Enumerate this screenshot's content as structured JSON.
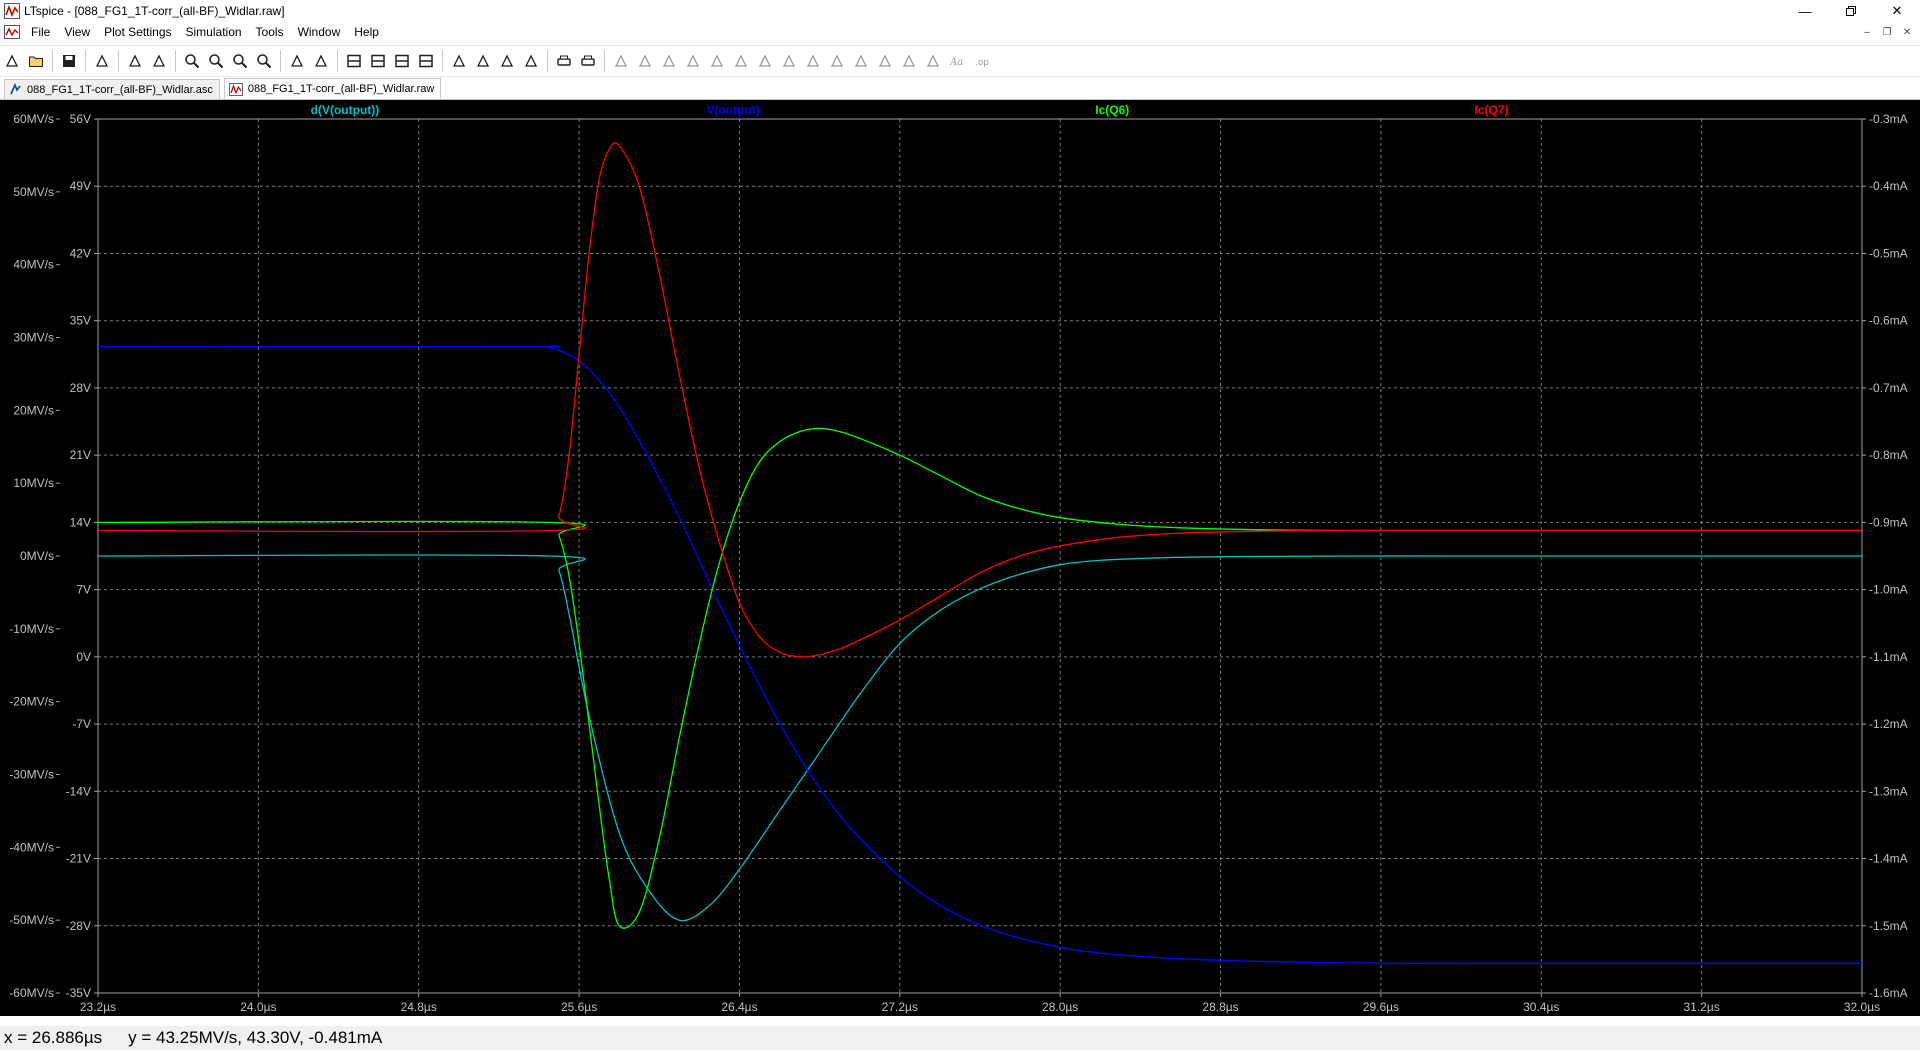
{
  "window": {
    "title": "LTspice - [088_FG1_1T-corr_(all-BF)_Widlar.raw]"
  },
  "menu": {
    "items": [
      "File",
      "View",
      "Plot Settings",
      "Simulation",
      "Tools",
      "Window",
      "Help"
    ]
  },
  "toolbar": {
    "groups": [
      [
        "new-schematic-icon",
        "open-icon"
      ],
      [
        "save-icon"
      ],
      [
        "control-panel-icon"
      ],
      [
        "run-icon",
        "halt-icon"
      ],
      [
        "zoom-in-icon",
        "zoom-area-icon",
        "zoom-out-icon",
        "zoom-cancel-icon"
      ],
      [
        "autorange-icon",
        "fit-y-icon"
      ],
      [
        "tile-horizontal-icon",
        "tile-vertical-icon",
        "cascade-icon",
        "close-all-icon"
      ],
      [
        "cut-icon",
        "copy-icon",
        "paste-icon",
        "find-icon"
      ],
      [
        "print-setup-icon",
        "print-icon"
      ],
      [
        "wire-icon",
        "ground-icon",
        "label-icon",
        "resistor-icon",
        "capacitor-icon",
        "inductor-icon",
        "diode-icon",
        "component-icon",
        "move-icon",
        "drag-icon",
        "undo-icon",
        "redo-icon",
        "rotate-icon",
        "mirror-icon",
        "text-icon",
        "spice-directive-icon"
      ]
    ]
  },
  "tabs": [
    {
      "label": "088_FG1_1T-corr_(all-BF)_Widlar.asc",
      "icon": "schematic-icon",
      "active": false
    },
    {
      "label": "088_FG1_1T-corr_(all-BF)_Widlar.raw",
      "icon": "waveform-icon",
      "active": true
    }
  ],
  "status": {
    "x_readout": "x = 26.886µs",
    "y_readout": "y = 43.25MV/s, 43.30V, -0.481mA"
  },
  "chart_data": {
    "type": "line",
    "background": "#000000",
    "grid": true,
    "x": {
      "min": 23.2,
      "max": 32.0,
      "unit": "µs",
      "ticks": [
        23.2,
        24.0,
        24.8,
        25.6,
        26.4,
        27.2,
        28.0,
        28.8,
        29.6,
        30.4,
        31.2,
        32.0
      ],
      "tick_labels": [
        "23.2µs",
        "24.0µs",
        "24.8µs",
        "25.6µs",
        "26.4µs",
        "27.2µs",
        "28.0µs",
        "28.8µs",
        "29.6µs",
        "30.4µs",
        "31.2µs",
        "32.0µs"
      ]
    },
    "axes": {
      "dv": {
        "min": -60,
        "max": 60,
        "ticks": [
          60,
          50,
          40,
          30,
          20,
          10,
          0,
          -10,
          -20,
          -30,
          -40,
          -50,
          -60
        ],
        "tick_labels": [
          "60MV/s",
          "50MV/s",
          "40MV/s",
          "30MV/s",
          "20MV/s",
          "10MV/s",
          "0MV/s",
          "-10MV/s",
          "-20MV/s",
          "-30MV/s",
          "-40MV/s",
          "-50MV/s",
          "-60MV/s"
        ]
      },
      "v": {
        "min": -35,
        "max": 56,
        "ticks": [
          56,
          49,
          42,
          35,
          28,
          21,
          14,
          7,
          0,
          -7,
          -14,
          -21,
          -28,
          -35
        ],
        "tick_labels": [
          "56V",
          "49V",
          "42V",
          "35V",
          "28V",
          "21V",
          "14V",
          "7V",
          "0V",
          "-7V",
          "-14V",
          "-21V",
          "-28V",
          "-35V"
        ]
      },
      "i": {
        "min": -1.6,
        "max": -0.3,
        "ticks": [
          -0.3,
          -0.4,
          -0.5,
          -0.6,
          -0.7,
          -0.8,
          -0.9,
          -1.0,
          -1.1,
          -1.2,
          -1.3,
          -1.4,
          -1.5,
          -1.6
        ],
        "tick_labels": [
          "-0.3mA",
          "-0.4mA",
          "-0.5mA",
          "-0.6mA",
          "-0.7mA",
          "-0.8mA",
          "-0.9mA",
          "-1.0mA",
          "-1.1mA",
          "-1.2mA",
          "-1.3mA",
          "-1.4mA",
          "-1.5mA",
          "-1.6mA"
        ]
      }
    },
    "series": [
      {
        "name": "d(V(output))",
        "color": "#00c0c0",
        "axis": "dv",
        "x": [
          23.2,
          25.45,
          25.5,
          25.55,
          25.65,
          25.8,
          25.95,
          26.1,
          26.25,
          26.4,
          26.6,
          26.8,
          27.0,
          27.2,
          27.4,
          27.6,
          27.8,
          28.0,
          28.2,
          28.5,
          28.8,
          29.0,
          29.5,
          30.0,
          31.0,
          32.0
        ],
        "y": [
          0,
          0,
          -2,
          -8,
          -22,
          -38,
          -46,
          -50,
          -48,
          -43,
          -35,
          -27,
          -19,
          -12,
          -7.5,
          -4.5,
          -2.5,
          -1.2,
          -0.6,
          -0.25,
          -0.1,
          -0.05,
          0,
          0,
          0,
          0
        ]
      },
      {
        "name": "V(output)",
        "color": "#0000ff",
        "axis": "v",
        "x": [
          23.2,
          25.3,
          25.45,
          25.6,
          25.75,
          25.9,
          26.1,
          26.3,
          26.5,
          26.7,
          26.9,
          27.1,
          27.3,
          27.5,
          27.7,
          27.9,
          28.1,
          28.4,
          28.8,
          29.2,
          29.6,
          30.0,
          31.0,
          32.0
        ],
        "y": [
          32.3,
          32.3,
          32.2,
          30.8,
          27.5,
          22.5,
          14.5,
          5.5,
          -3,
          -10.5,
          -16.5,
          -21,
          -24.5,
          -27,
          -28.7,
          -29.8,
          -30.6,
          -31.2,
          -31.6,
          -31.8,
          -31.9,
          -31.9,
          -31.9,
          -31.9
        ]
      },
      {
        "name": "Ic(Q6)",
        "color": "#00ff00",
        "axis": "i",
        "x": [
          23.2,
          25.45,
          25.5,
          25.55,
          25.6,
          25.65,
          25.7,
          25.75,
          25.8,
          25.9,
          26.0,
          26.1,
          26.2,
          26.3,
          26.4,
          26.5,
          26.6,
          26.7,
          26.8,
          26.9,
          27.0,
          27.2,
          27.4,
          27.6,
          27.8,
          28.0,
          28.3,
          28.6,
          29.0,
          29.4,
          29.6,
          30.0,
          31.0,
          32.0
        ],
        "y": [
          -0.9,
          -0.9,
          -0.92,
          -0.98,
          -1.08,
          -1.2,
          -1.32,
          -1.43,
          -1.5,
          -1.48,
          -1.37,
          -1.22,
          -1.08,
          -0.96,
          -0.87,
          -0.81,
          -0.78,
          -0.765,
          -0.76,
          -0.765,
          -0.775,
          -0.8,
          -0.83,
          -0.86,
          -0.88,
          -0.893,
          -0.903,
          -0.908,
          -0.911,
          -0.912,
          -0.912,
          -0.912,
          -0.912,
          -0.912
        ]
      },
      {
        "name": "Ic(Q7)",
        "color": "#ff0000",
        "axis": "i",
        "x": [
          23.2,
          25.45,
          25.5,
          25.55,
          25.6,
          25.65,
          25.7,
          25.75,
          25.8,
          25.9,
          26.0,
          26.1,
          26.2,
          26.3,
          26.4,
          26.5,
          26.6,
          26.7,
          26.8,
          26.9,
          27.0,
          27.2,
          27.4,
          27.6,
          27.8,
          28.0,
          28.3,
          28.6,
          29.0,
          29.4,
          29.6,
          30.0,
          31.0,
          32.0
        ],
        "y": [
          -0.912,
          -0.912,
          -0.89,
          -0.8,
          -0.65,
          -0.5,
          -0.39,
          -0.345,
          -0.34,
          -0.4,
          -0.53,
          -0.68,
          -0.82,
          -0.93,
          -1.02,
          -1.07,
          -1.093,
          -1.1,
          -1.097,
          -1.088,
          -1.075,
          -1.045,
          -1.01,
          -0.975,
          -0.95,
          -0.935,
          -0.922,
          -0.916,
          -0.913,
          -0.912,
          -0.912,
          -0.912,
          -0.912,
          -0.912
        ]
      }
    ]
  }
}
